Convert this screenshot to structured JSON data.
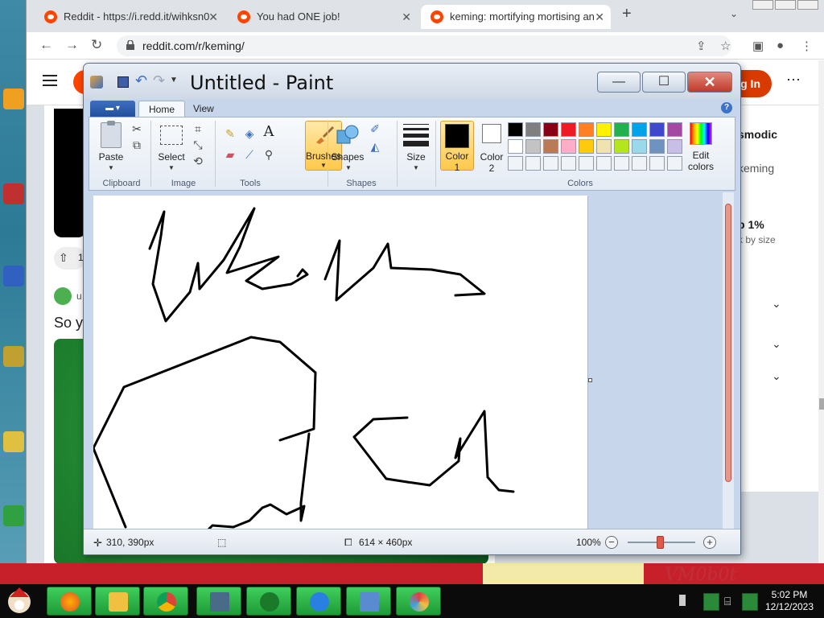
{
  "browser": {
    "tabs": [
      {
        "label": "Reddit - https://i.redd.it/wihksn0",
        "active": false
      },
      {
        "label": "You had ONE job!",
        "active": false
      },
      {
        "label": "keming: mortifying mortising an",
        "active": true
      }
    ],
    "url": "reddit.com/r/keming/"
  },
  "reddit": {
    "login_label": "g In",
    "post_vote": "1",
    "post_user": "u",
    "post_title": "So y",
    "sidebar": {
      "line1": "smodic",
      "line2": "keming",
      "line3": "p 1%",
      "line4": "k by size"
    }
  },
  "paint": {
    "title": "Untitled - Paint",
    "tabs": [
      "Home",
      "View"
    ],
    "groups": {
      "clipboard": "Clipboard",
      "image": "Image",
      "tools": "Tools",
      "shapes": "Shapes",
      "colors": "Colors"
    },
    "buttons": {
      "paste": "Paste",
      "select": "Select",
      "brushes": "Brushes",
      "shapes": "Shapes",
      "size": "Size",
      "color1_a": "Color",
      "color1_b": "1",
      "color2_a": "Color",
      "color2_b": "2",
      "edit_colors_a": "Edit",
      "edit_colors_b": "colors"
    },
    "palette_row1": [
      "#000000",
      "#7f7f7f",
      "#880015",
      "#ed1c24",
      "#ff7f27",
      "#fff200",
      "#22b14c",
      "#00a2e8",
      "#3f48cc",
      "#a349a4"
    ],
    "palette_row2": [
      "#ffffff",
      "#c3c3c3",
      "#b97a57",
      "#ffaec9",
      "#ffc90e",
      "#efe4b0",
      "#b5e61d",
      "#99d9ea",
      "#7092be",
      "#c8bfe7"
    ],
    "status": {
      "cursor_pos": "310, 390px",
      "image_size": "614 × 460px",
      "zoom": "100%"
    }
  },
  "taskbar": {
    "time": "5:02 PM",
    "date": "12/12/2023"
  },
  "desktop": {
    "signature": "VM0b0t"
  }
}
